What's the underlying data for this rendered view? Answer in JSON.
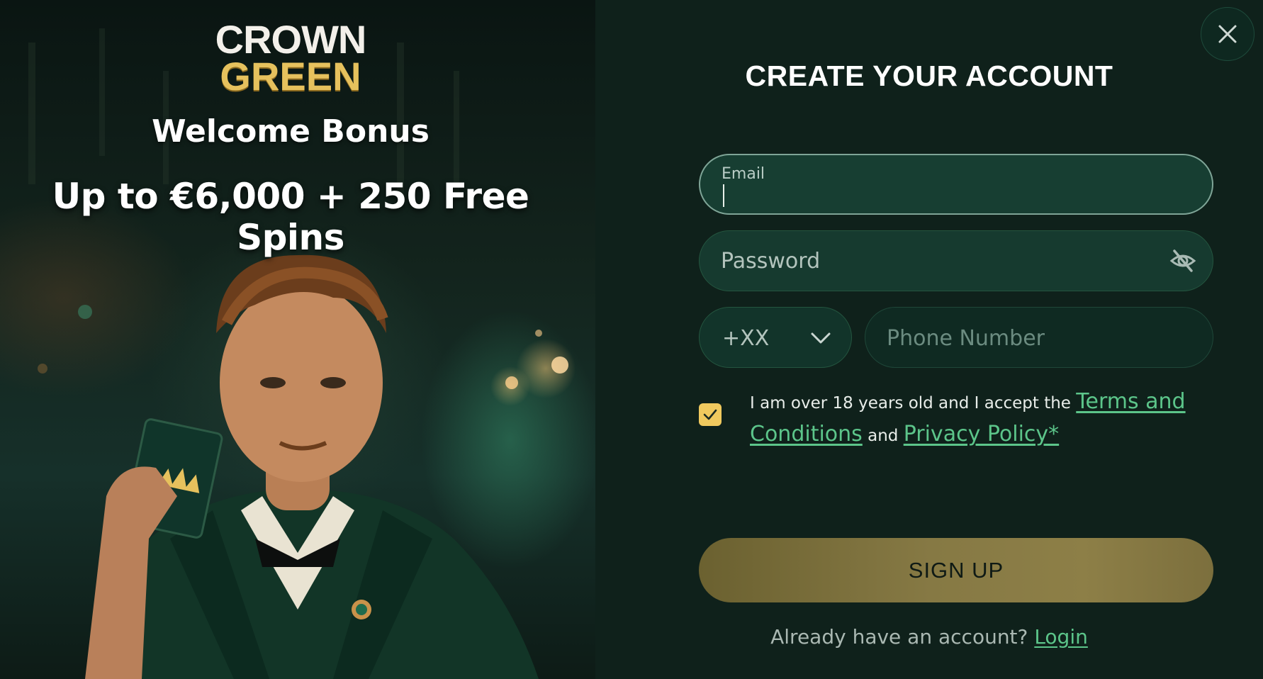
{
  "promo": {
    "logo_line1": "CROWN",
    "logo_line2": "GREEN",
    "bonus_label": "Welcome Bonus",
    "bonus_offer": "Up to €6,000 + 250 Free Spins"
  },
  "form": {
    "title": "CREATE YOUR ACCOUNT",
    "email_label": "Email",
    "email_value": "",
    "password_placeholder": "Password",
    "country_code": "+XX",
    "phone_placeholder": "Phone Number",
    "consent_prefix": "I am over 18 years old and I accept the ",
    "terms_link": "Terms and Conditions",
    "consent_and": " and ",
    "privacy_link": "Privacy Policy*",
    "consent_checked": true,
    "signup_label": "SIGN UP",
    "login_prompt": "Already have an account? ",
    "login_link": "Login"
  },
  "icons": {
    "close": "close-icon",
    "password_toggle": "eye-off-icon",
    "dropdown": "chevron-down-icon",
    "checkbox": "check-icon",
    "logo_crown": "crown-icon"
  },
  "colors": {
    "panel_background": "#0f211b",
    "accent_gold": "#f0c95e",
    "link_green": "#5cc58a",
    "button_gold": "#867944",
    "field_active": "#173e32"
  }
}
